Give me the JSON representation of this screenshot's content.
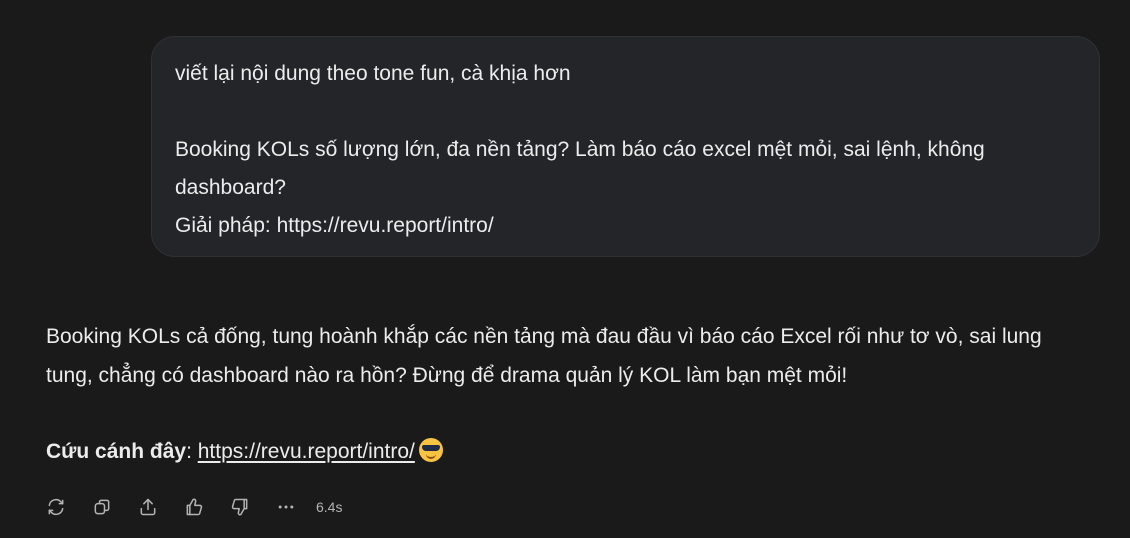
{
  "user_message": {
    "line1": "viết lại nội dung theo tone fun, cà khịa hơn",
    "line2": "Booking KOLs số lượng lớn, đa nền tảng? Làm báo cáo excel mệt mỏi, sai lệnh, không dashboard?",
    "line3": "Giải pháp: https://revu.report/intro/"
  },
  "assistant_message": {
    "paragraph1": "Booking KOLs cả đống, tung hoành khắp các nền tảng mà đau đầu vì báo cáo Excel rối như tơ vò, sai lung tung, chẳng có dashboard nào ra hồn? Đừng để drama quản lý KOL làm bạn mệt mỏi!",
    "cta_label": "Cứu cánh đây",
    "cta_separator": ": ",
    "link": "https://revu.report/intro/",
    "emoji": "sunglasses-emoji"
  },
  "actions": {
    "icons": [
      "regenerate-icon",
      "copy-icon",
      "share-icon",
      "thumbs-up-icon",
      "thumbs-down-icon",
      "more-icon"
    ],
    "timing": "6.4s"
  }
}
